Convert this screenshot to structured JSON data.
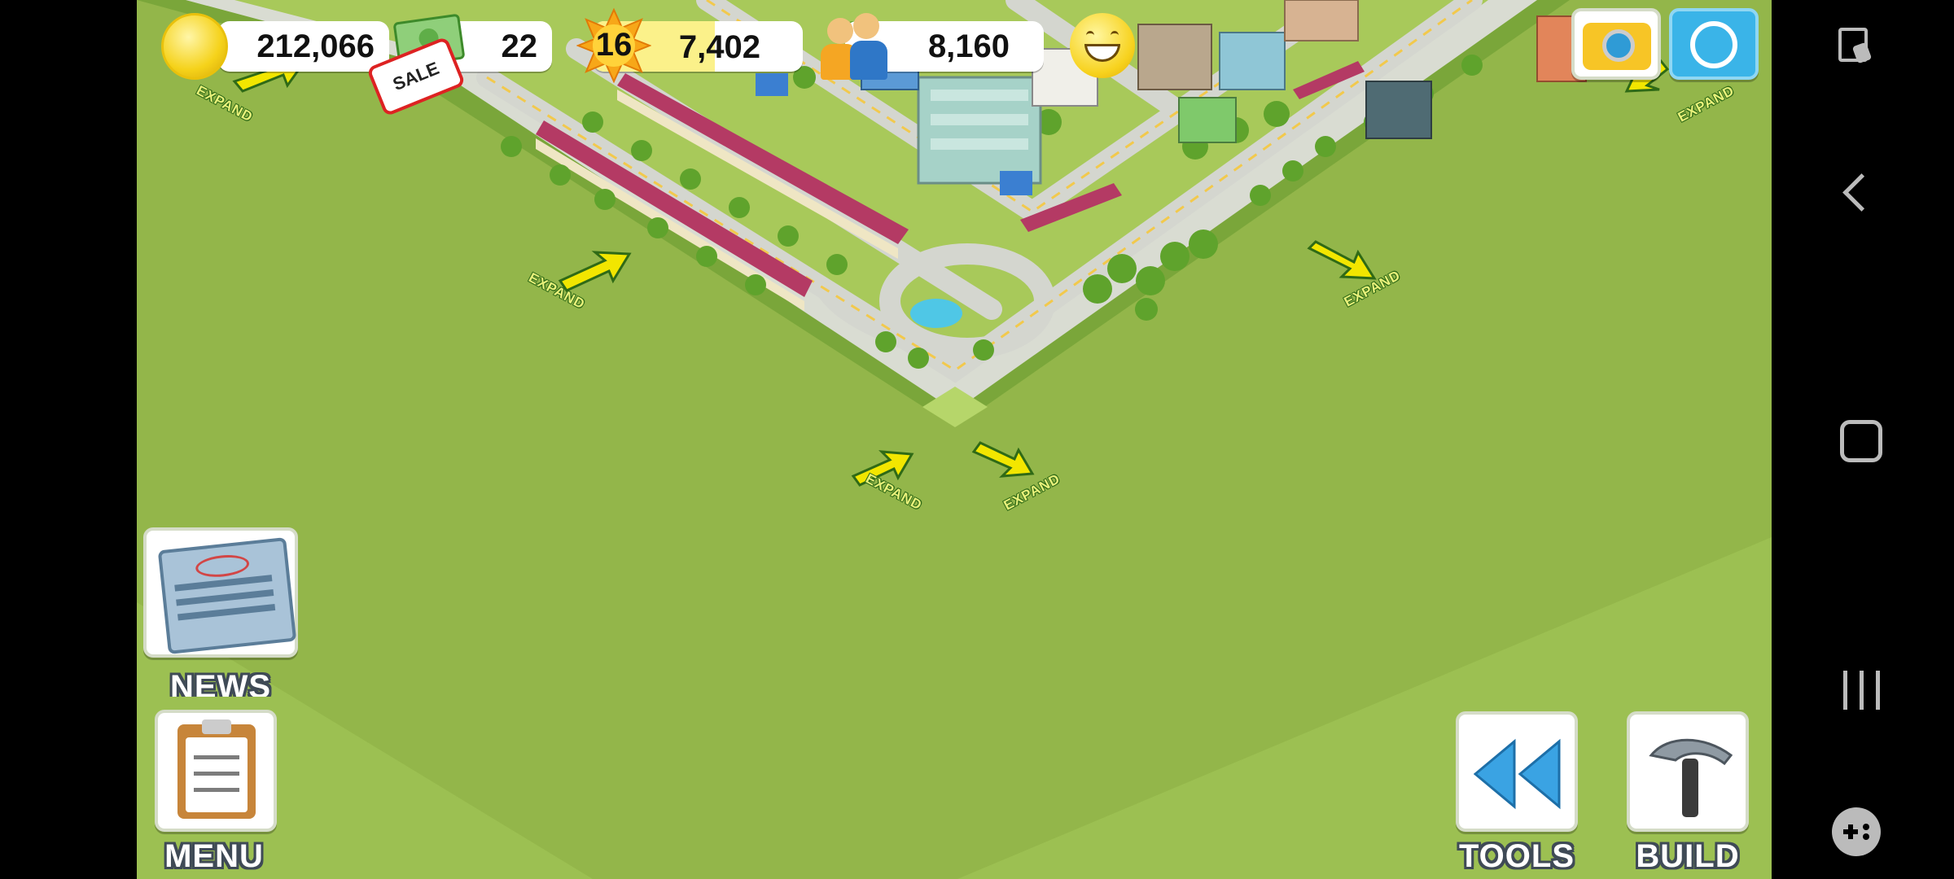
{
  "hud": {
    "coins": "212,066",
    "cash": "22",
    "sale_badge": "SALE",
    "level": "16",
    "xp": "7,402",
    "population": "8,160"
  },
  "map": {
    "expand_label": "EXPAND"
  },
  "buttons": {
    "news": "NEWS",
    "menu": "MENU",
    "tools": "TOOLS",
    "build": "BUILD"
  },
  "colors": {
    "grass": "#93b64a",
    "label_text": "#ffffff",
    "label_outline": "#3f4a56",
    "expand_arrow": "#f2e600"
  },
  "icons": {
    "coins": "gold-coin-icon",
    "cash": "dollar-bill-icon",
    "level": "star-burst-icon",
    "population": "people-icon",
    "happiness": "smiley-face-icon",
    "camera": "camera-icon",
    "share": "share-icon",
    "news": "newspaper-icon",
    "menu": "clipboard-icon",
    "tools": "rewind-icon",
    "build": "hammer-icon"
  }
}
